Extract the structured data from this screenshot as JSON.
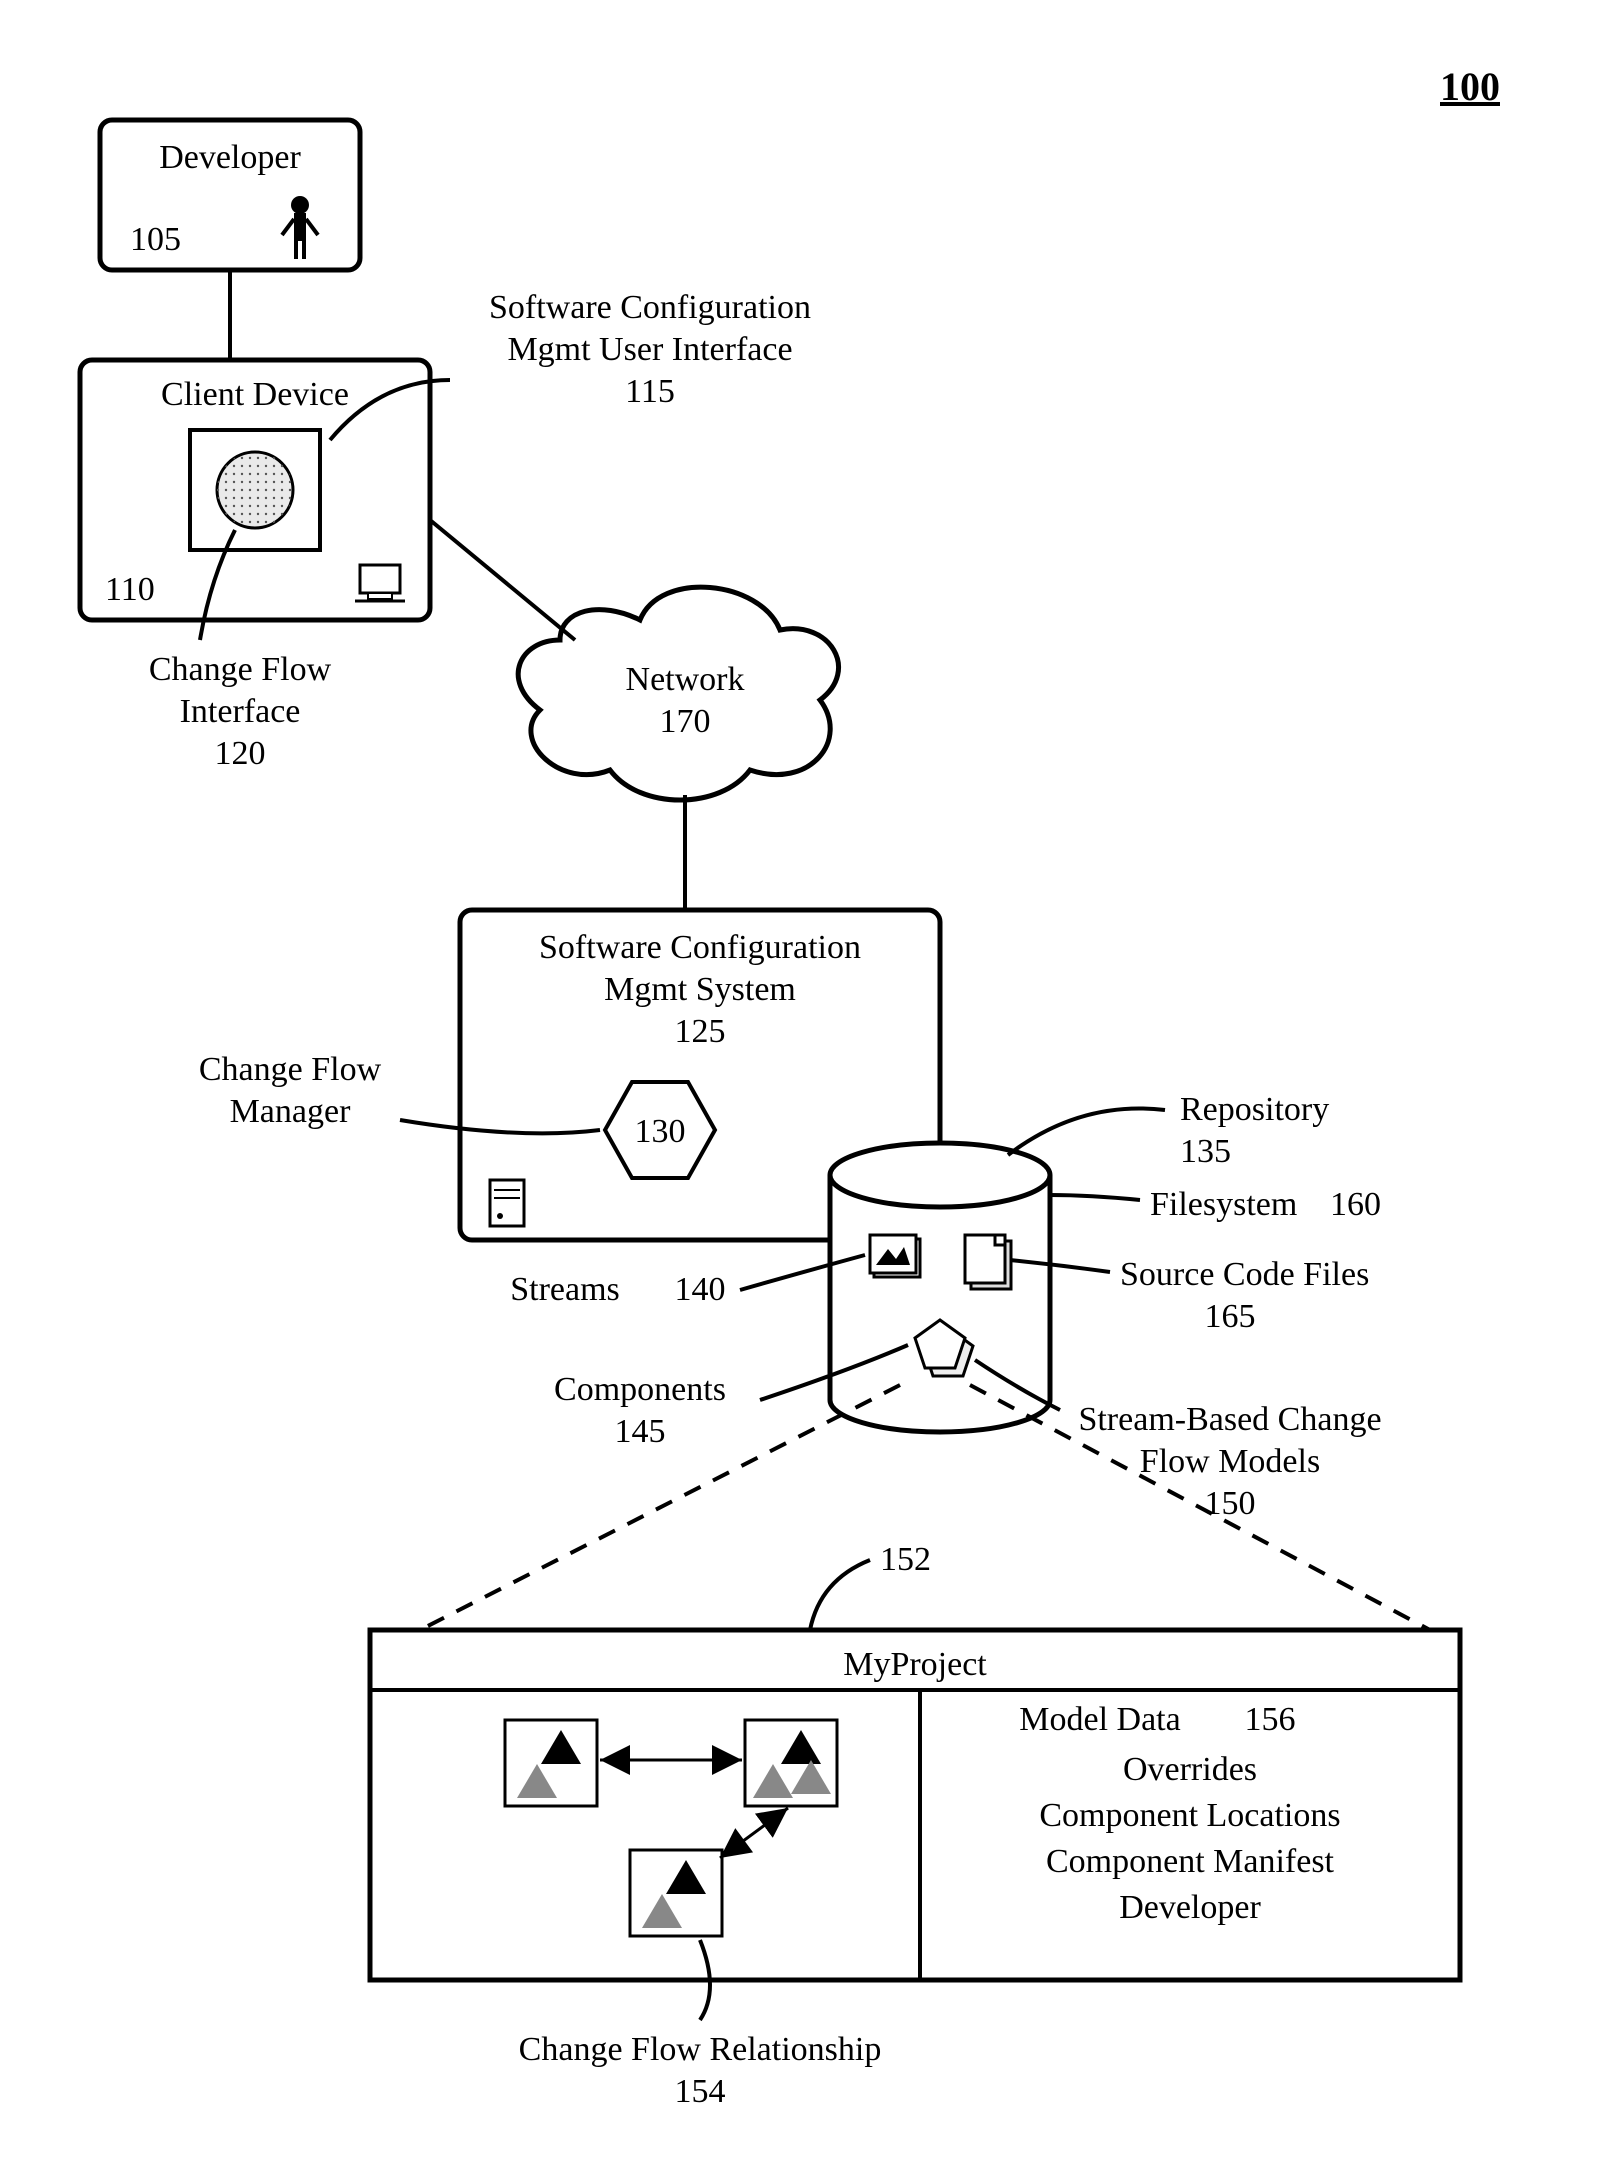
{
  "figure_number": "100",
  "developer": {
    "label": "Developer",
    "num": "105"
  },
  "client_device": {
    "label": "Client Device",
    "num": "110"
  },
  "scm_ui": {
    "label1": "Software Configuration",
    "label2": "Mgmt User Interface",
    "num": "115"
  },
  "change_flow_interface": {
    "label1": "Change Flow",
    "label2": "Interface",
    "num": "120"
  },
  "network": {
    "label": "Network",
    "num": "170"
  },
  "scm_system": {
    "label1": "Software Configuration",
    "label2": "Mgmt System",
    "num": "125"
  },
  "change_flow_manager": {
    "label1": "Change Flow",
    "label2": "Manager",
    "num": "130"
  },
  "repository": {
    "label": "Repository",
    "num": "135"
  },
  "streams": {
    "label": "Streams",
    "num": "140"
  },
  "components": {
    "label": "Components",
    "num": "145"
  },
  "sbcfm": {
    "label1": "Stream-Based Change",
    "label2": "Flow Models",
    "num": "150"
  },
  "filesystem": {
    "label": "Filesystem",
    "num": "160"
  },
  "source_code_files": {
    "label": "Source Code Files",
    "num": "165"
  },
  "myproject": {
    "label": "MyProject",
    "num": "152"
  },
  "change_flow_relationship": {
    "label": "Change Flow Relationship",
    "num": "154"
  },
  "model_data": {
    "label": "Model Data",
    "num": "156",
    "items": [
      "Overrides",
      "Component Locations",
      "Component Manifest",
      "Developer"
    ]
  }
}
